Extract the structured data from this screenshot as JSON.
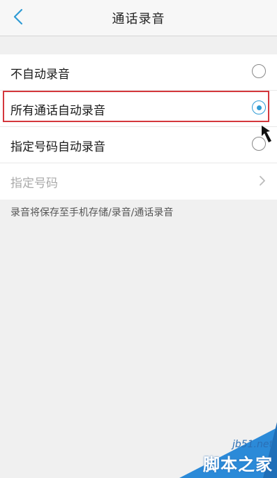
{
  "header": {
    "title": "通话录音",
    "back_icon": "chevron-left-icon",
    "accent_color": "#2f9bd5"
  },
  "options": [
    {
      "label": "不自动录音",
      "selected": false
    },
    {
      "label": "所有通话自动录音",
      "selected": true
    },
    {
      "label": "指定号码自动录音",
      "selected": false
    }
  ],
  "specified_numbers": {
    "label": "指定号码",
    "enabled": false,
    "icon": "chevron-right-icon"
  },
  "footnote": "录音将保存至手机存储/录音/通话录音",
  "annotation": {
    "highlight_color": "#d4373c"
  },
  "watermark": {
    "url": "jb51.net",
    "name": "脚本之家"
  }
}
